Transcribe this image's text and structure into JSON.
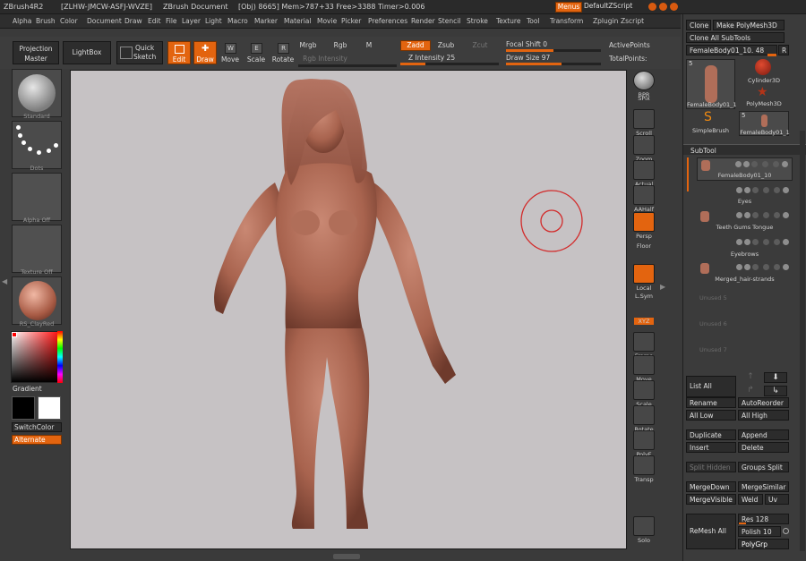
{
  "titlebar": {
    "app": "ZBrush4R2",
    "id": "[ZLHW-JMCW-ASFJ-WVZE]",
    "doc": "ZBrush Document",
    "stats": "[Obj) 8665] Mem>787+33 Free>3388 Timer>0.006",
    "menus_btn": "Menus",
    "script_btn": "DefaultZScript"
  },
  "menubar": [
    "Alpha",
    "Brush",
    "Color",
    "Document",
    "Draw",
    "Edit",
    "File",
    "Layer",
    "Light",
    "Macro",
    "Marker",
    "Material",
    "Movie",
    "Picker",
    "Preferences",
    "Render",
    "Stencil",
    "Stroke",
    "Texture",
    "Tool",
    "Transform",
    "Zplugin",
    "Zscript"
  ],
  "toolbar": {
    "projection": "Projection\nMaster",
    "lightbox": "LightBox",
    "quick_sketch": "Quick\nSketch",
    "edit": "Edit",
    "draw": "Draw",
    "move": "Move",
    "scale": "Scale",
    "rotate": "Rotate",
    "mrgb": "Mrgb",
    "rgb": "Rgb",
    "m": "M",
    "zadd": "Zadd",
    "zsub": "Zsub",
    "zcut": "Zcut",
    "rgb_intensity": "Rgb Intensity",
    "z_intensity": "Z Intensity 25",
    "focal_shift": "Focal Shift 0",
    "draw_size": "Draw Size 97",
    "active_points": "ActivePoints",
    "total_points": "TotalPoints:",
    "z_intensity_value": 25,
    "focal_shift_value": 0,
    "draw_size_value": 97
  },
  "left_shelf": {
    "standard": "Standard",
    "dots": "Dots",
    "alpha_off": "Alpha Off",
    "texture_off": "Texture Off",
    "material": "RS_ClayRed",
    "gradient": "Gradient",
    "switch_color": "SwitchColor",
    "alternate": "Alternate"
  },
  "right_shelf": [
    "BPR",
    "SPix",
    "Scroll",
    "Zoom",
    "Actual",
    "AAHalf",
    "Persp",
    "Floor",
    "Local",
    "L.Sym",
    "XYZ",
    "Frame",
    "Move",
    "Scale",
    "Rotate",
    "PolyF",
    "Transp",
    "Solo"
  ],
  "tool_panel": {
    "clone": "Clone",
    "make_polymesh": "Make PolyMesh3D",
    "clone_all": "Clone All SubTools",
    "current_tool": "FemaleBody01_10. 48",
    "r": "R",
    "tool_count": "5",
    "tool_count_small": "5",
    "thumbs": [
      "FemaleBody01_1",
      "Cylinder3D",
      "PolyMesh3D",
      "SimpleBrush",
      "FemaleBody01_1"
    ],
    "subtool_header": "SubTool",
    "subtools": [
      "FemaleBody01_10",
      "Eyes",
      "Teeth Gums Tongue",
      "Eyebrows",
      "Merged_hair-strands",
      "Unused 5",
      "Unused 6",
      "Unused 7"
    ],
    "list_all": "List All",
    "rename": "Rename",
    "auto_reorder": "AutoReorder",
    "all_low": "All Low",
    "all_high": "All High",
    "duplicate": "Duplicate",
    "append": "Append",
    "insert": "Insert",
    "delete": "Delete",
    "split_hidden": "Split Hidden",
    "groups_split": "Groups Split",
    "merge_down": "MergeDown",
    "merge_similar": "MergeSimilar",
    "merge_visible": "MergeVisible",
    "weld": "Weld",
    "uv": "Uv",
    "remesh_all": "ReMesh All",
    "res": "Res 128",
    "polish": "Polish 10",
    "polygrp": "PolyGrp"
  },
  "colors": {
    "accent": "#e3640f",
    "canvas": "#c6c2c4",
    "skin": "#a8634e"
  }
}
